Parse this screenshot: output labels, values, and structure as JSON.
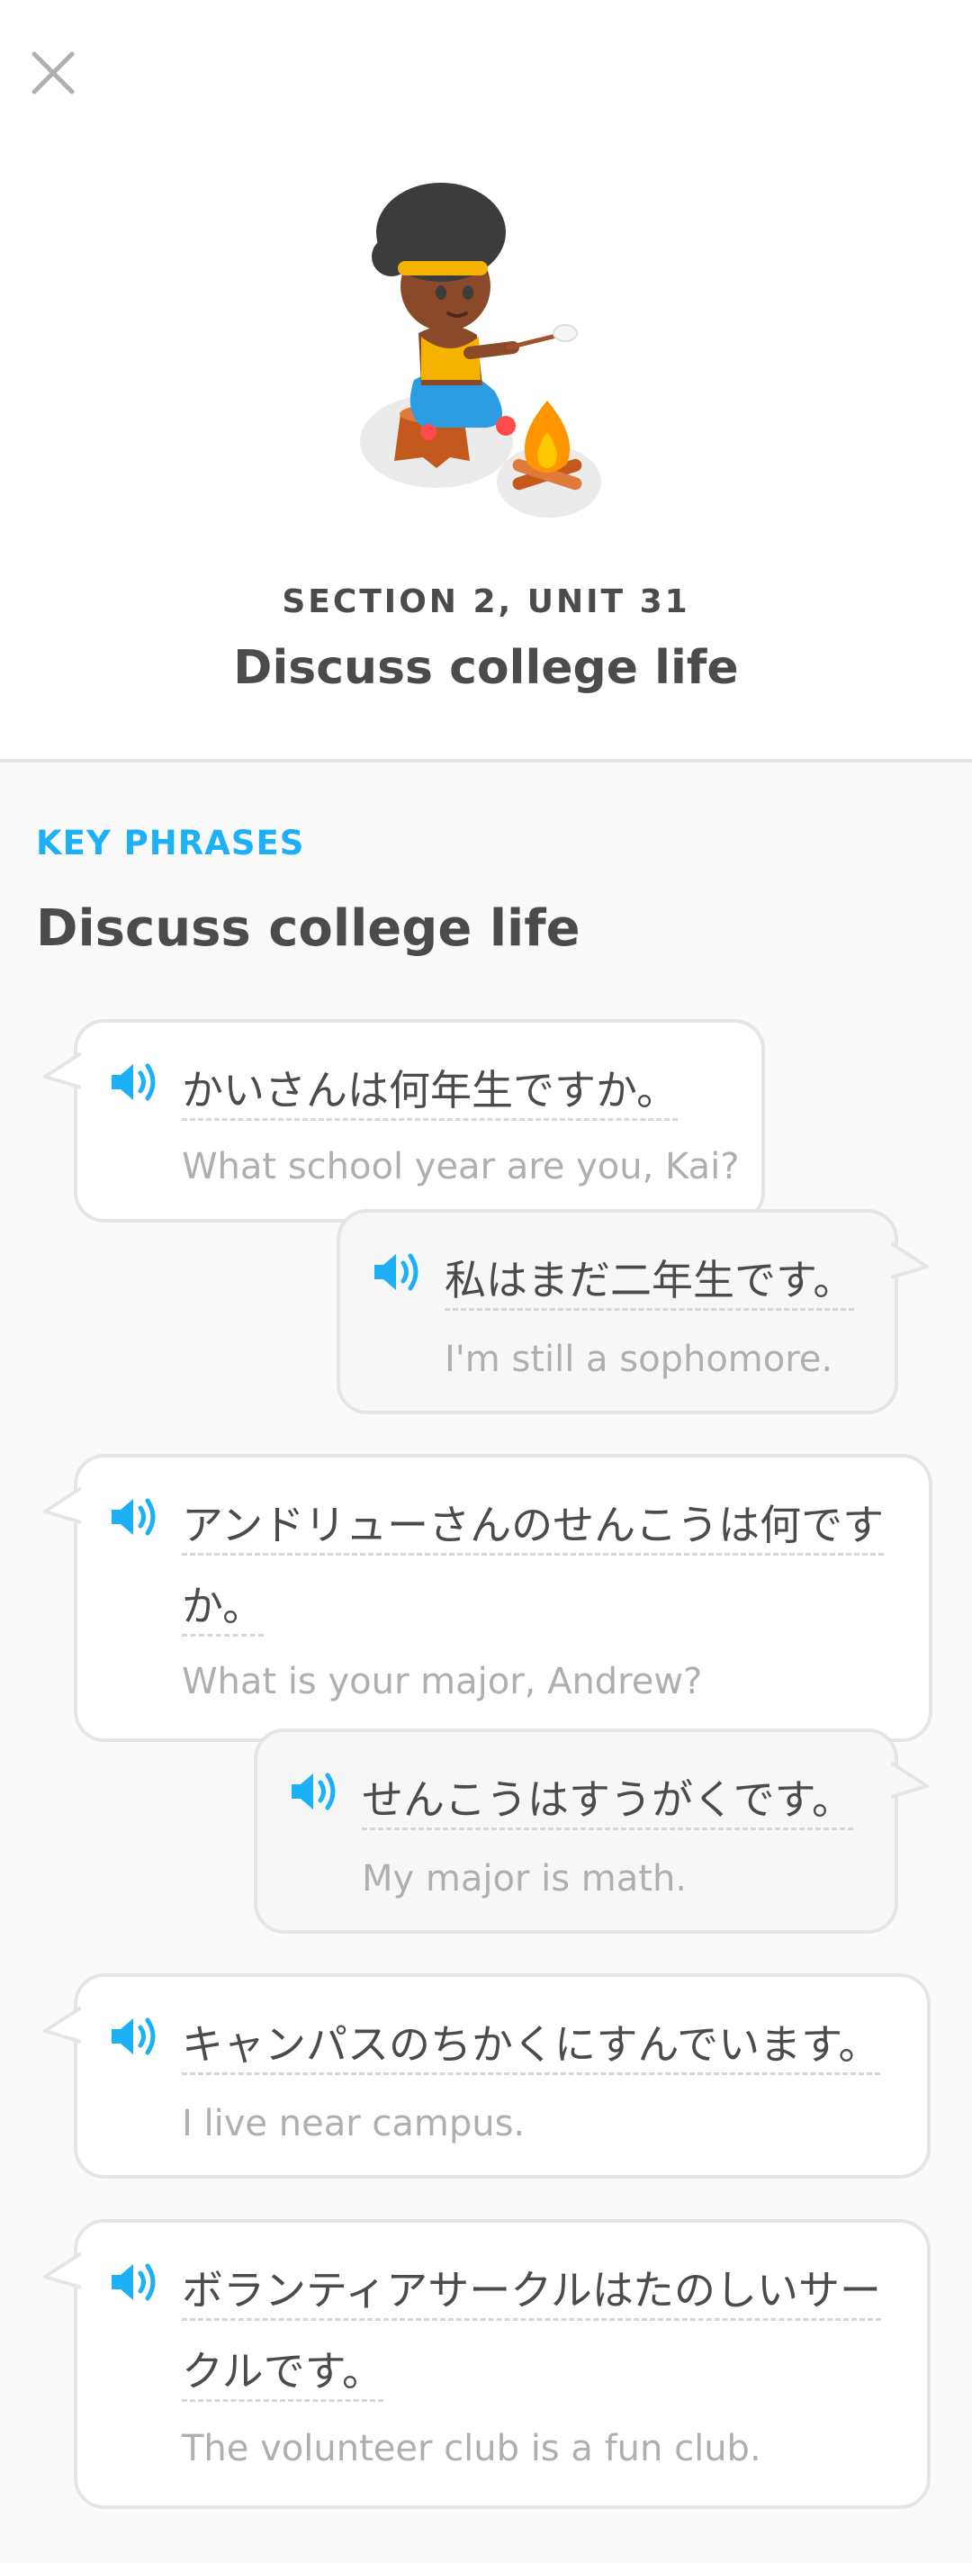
{
  "header": {
    "close_icon": "close-icon",
    "section": "SECTION 2, UNIT 31",
    "unit_title": "Discuss college life"
  },
  "key_phrases": {
    "label": "KEY PHRASES",
    "title": "Discuss college life",
    "phrases": [
      {
        "side": "left",
        "jp": [
          "かいさんは何年生ですか。"
        ],
        "en": "What school year are you, Kai?"
      },
      {
        "side": "right",
        "jp": [
          "私はまだ二年生です。"
        ],
        "en": "I'm still a sophomore."
      },
      {
        "side": "left",
        "jp": [
          "アンドリューさんのせんこうは何です",
          "か。"
        ],
        "en": "What is your major, Andrew?"
      },
      {
        "side": "right",
        "jp": [
          "せんこうはすうがくです。"
        ],
        "en": "My major is math."
      },
      {
        "side": "left",
        "jp": [
          "キャンパスのちかくにすんでいます。"
        ],
        "en": "I live near campus."
      },
      {
        "side": "left",
        "jp": [
          "ボランティアサークルはたのしいサー",
          "クルです。"
        ],
        "en": "The volunteer club is a fun club."
      }
    ]
  },
  "colors": {
    "accent_blue": "#1cb0f6",
    "text_dark": "#4b4b4b",
    "text_muted": "#afafaf",
    "border": "#e5e5e5"
  }
}
